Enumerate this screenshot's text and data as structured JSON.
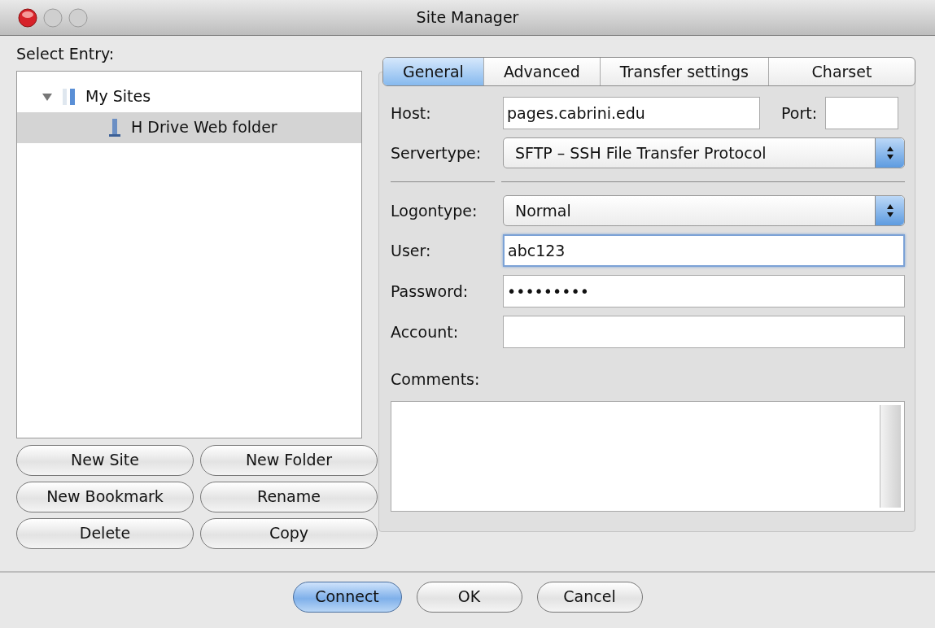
{
  "window": {
    "title": "Site Manager"
  },
  "select_entry": {
    "label": "Select Entry:"
  },
  "tree": [
    {
      "label": "My Sites",
      "expanded": true,
      "selected": false,
      "children": [
        {
          "label": "H Drive Web folder",
          "selected": true
        }
      ]
    }
  ],
  "site_buttons": [
    "New Site",
    "New Folder",
    "New Bookmark",
    "Rename",
    "Delete",
    "Copy"
  ],
  "tabs": [
    {
      "label": "General",
      "selected": true
    },
    {
      "label": "Advanced",
      "selected": false
    },
    {
      "label": "Transfer settings",
      "selected": false
    },
    {
      "label": "Charset",
      "selected": false
    }
  ],
  "form": {
    "host": {
      "label": "Host:",
      "value": "pages.cabrini.edu"
    },
    "port": {
      "label": "Port:"
    },
    "servertype": {
      "label": "Servertype:",
      "value": "SFTP – SSH File Transfer Protocol"
    },
    "logontype": {
      "label": "Logontype:",
      "value": "Normal"
    },
    "user": {
      "label": "User:",
      "value": "abc123",
      "focused": true
    },
    "password": {
      "label": "Password:",
      "value": "•••••••••",
      "focused": false
    },
    "account": {
      "label": "Account:",
      "focused": false
    },
    "comments": {
      "label": "Comments:"
    }
  },
  "dialog_buttons": [
    {
      "label": "Connect",
      "default": true
    },
    {
      "label": "OK",
      "default": false
    },
    {
      "label": "Cancel",
      "default": false
    }
  ]
}
